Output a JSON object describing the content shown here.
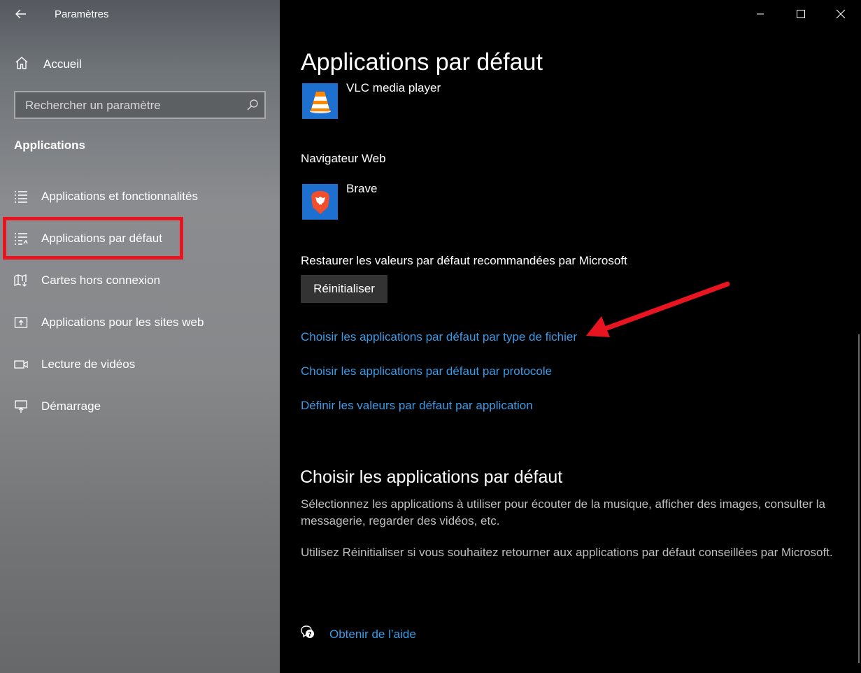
{
  "window": {
    "title": "Paramètres"
  },
  "sidebar": {
    "home_label": "Accueil",
    "search_placeholder": "Rechercher un paramètre",
    "section_title": "Applications",
    "items": [
      {
        "label": "Applications et fonctionnalités",
        "icon": "apps-features-icon"
      },
      {
        "label": "Applications par défaut",
        "icon": "default-apps-icon",
        "selected": true
      },
      {
        "label": "Cartes hors connexion",
        "icon": "offline-maps-icon"
      },
      {
        "label": "Applications pour les sites web",
        "icon": "apps-for-websites-icon"
      },
      {
        "label": "Lecture de vidéos",
        "icon": "video-playback-icon"
      },
      {
        "label": "Démarrage",
        "icon": "startup-icon"
      }
    ]
  },
  "main": {
    "title": "Applications par défaut",
    "video_player_app": "VLC media player",
    "browser_label": "Navigateur Web",
    "browser_app": "Brave",
    "reset_label": "Restaurer les valeurs par défaut recommandées par Microsoft",
    "reset_button": "Réinitialiser",
    "links": [
      "Choisir les applications par défaut par type de fichier",
      "Choisir les applications par défaut par protocole",
      "Définir les valeurs par défaut par application"
    ],
    "info_title": "Choisir les applications par défaut",
    "info_text_1": "Sélectionnez les applications à utiliser pour écouter de la musique, afficher des images, consulter la messagerie, regarder des vidéos, etc.",
    "info_text_2": "Utilisez Réinitialiser si vous souhaitez retourner aux applications par défaut conseillées par Microsoft.",
    "help_link": "Obtenir de l’aide"
  },
  "colors": {
    "link": "#3b9be6",
    "highlight_box": "#e8141f",
    "annotation_arrow": "#e8141f",
    "tile_bg": "#1d6fd0"
  }
}
